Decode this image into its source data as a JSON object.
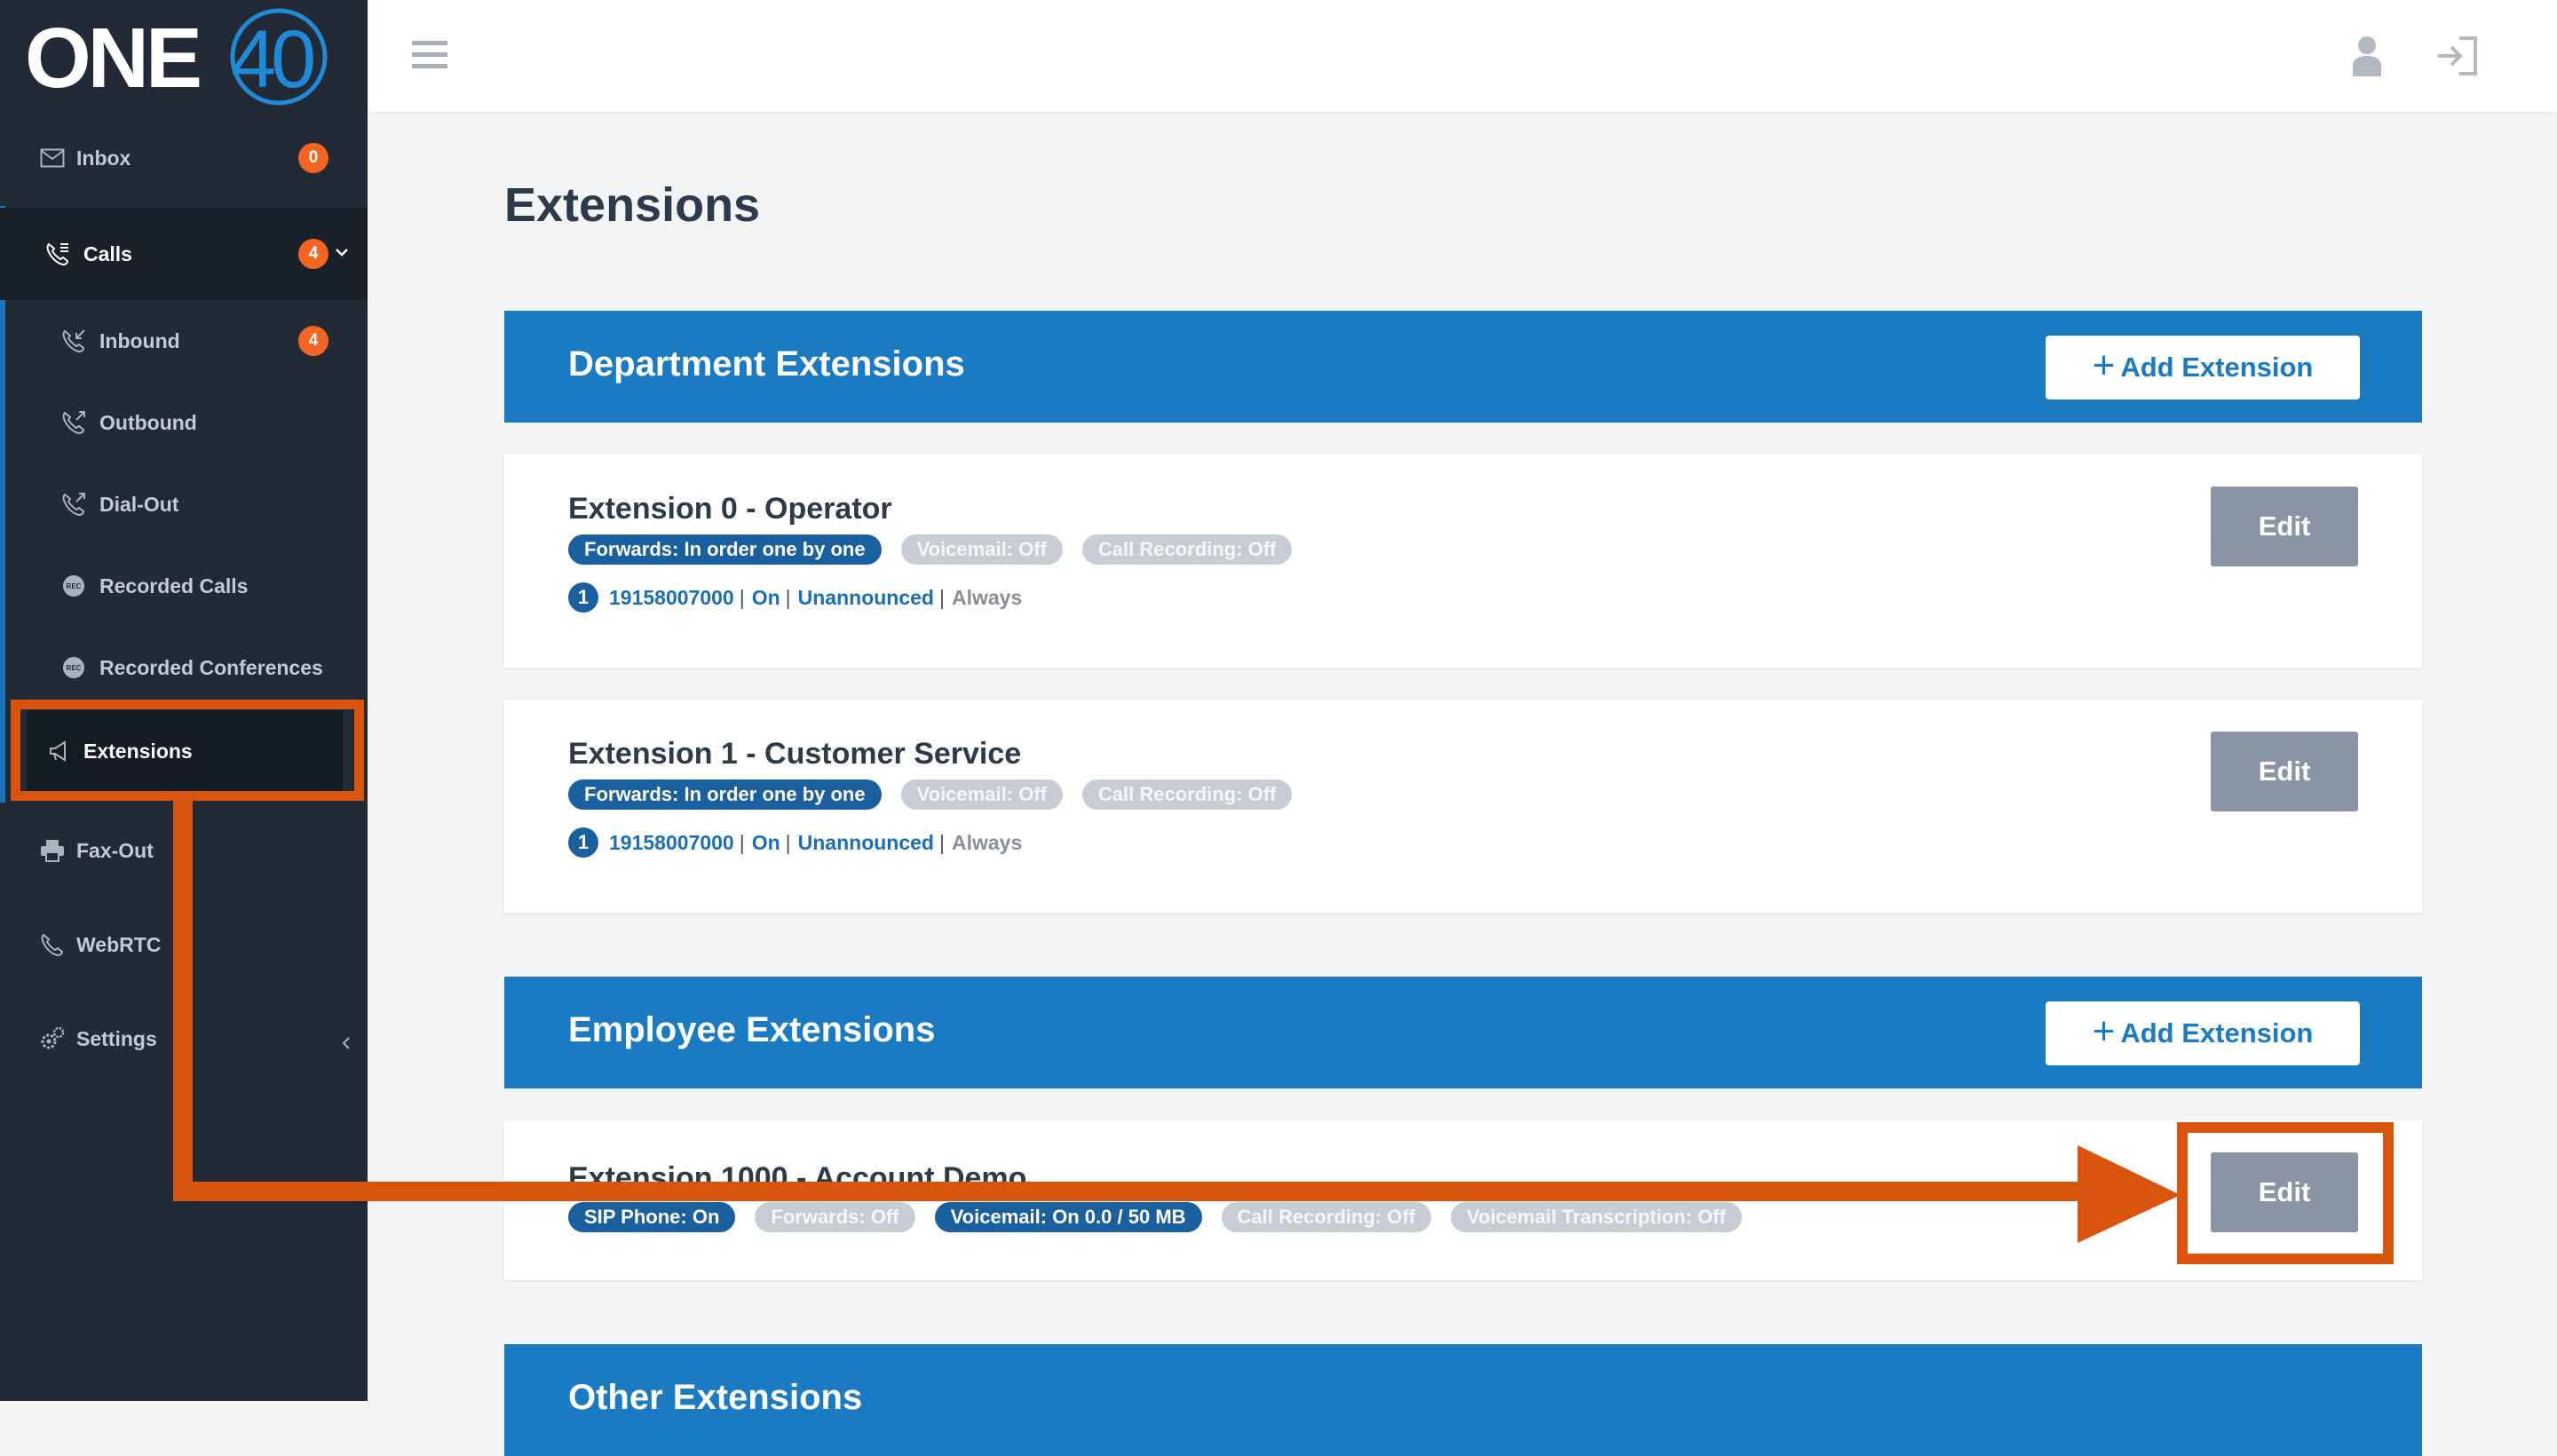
{
  "logo": {
    "text_left": "ONE",
    "text_right": "40"
  },
  "sidebar": {
    "items": [
      {
        "label": "Inbox",
        "badge": "0",
        "icon": "envelope-icon"
      },
      {
        "label": "Calls",
        "badge": "4",
        "icon": "phone-list-icon",
        "expanded": true
      },
      {
        "label": "Inbound",
        "badge": "4",
        "icon": "phone-inbound-icon"
      },
      {
        "label": "Outbound",
        "icon": "phone-outbound-icon"
      },
      {
        "label": "Dial-Out",
        "icon": "phone-dialout-icon"
      },
      {
        "label": "Recorded Calls",
        "icon": "rec-icon"
      },
      {
        "label": "Recorded Conferences",
        "icon": "rec-icon"
      },
      {
        "label": "Extensions",
        "icon": "megaphone-icon",
        "active": true
      },
      {
        "label": "Fax-Out",
        "icon": "printer-icon"
      },
      {
        "label": "WebRTC",
        "icon": "phone-icon"
      },
      {
        "label": "Settings",
        "icon": "gears-icon"
      }
    ]
  },
  "page": {
    "title": "Extensions"
  },
  "sections": {
    "department": {
      "title": "Department Extensions",
      "add_label": "Add Extension"
    },
    "employee": {
      "title": "Employee Extensions",
      "add_label": "Add Extension"
    },
    "other": {
      "title": "Other Extensions"
    }
  },
  "extensions": [
    {
      "title": "Extension 0 - Operator",
      "tags": [
        {
          "text": "Forwards: In order one by one",
          "on": true
        },
        {
          "text": "Voicemail: Off",
          "on": false
        },
        {
          "text": "Call Recording: Off",
          "on": false
        }
      ],
      "forward": {
        "index": "1",
        "number": "19158007000",
        "state": "On",
        "announce": "Unannounced",
        "when": "Always"
      },
      "edit_label": "Edit"
    },
    {
      "title": "Extension 1 - Customer Service",
      "tags": [
        {
          "text": "Forwards: In order one by one",
          "on": true
        },
        {
          "text": "Voicemail: Off",
          "on": false
        },
        {
          "text": "Call Recording: Off",
          "on": false
        }
      ],
      "forward": {
        "index": "1",
        "number": "19158007000",
        "state": "On",
        "announce": "Unannounced",
        "when": "Always"
      },
      "edit_label": "Edit"
    },
    {
      "title": "Extension 1000 - Account Demo",
      "tags": [
        {
          "text": "SIP Phone: On",
          "on": true
        },
        {
          "text": "Forwards: Off",
          "on": false
        },
        {
          "text": "Voicemail: On 0.0 / 50 MB",
          "on": true
        },
        {
          "text": "Call Recording: Off",
          "on": false
        },
        {
          "text": "Voicemail Transcription: Off",
          "on": false
        }
      ],
      "edit_label": "Edit"
    }
  ],
  "colors": {
    "sidebar_bg": "#212a35",
    "accent_blue": "#1a7ac2",
    "badge_orange": "#f26522",
    "annotation_orange": "#d9540c",
    "edit_button": "#8995a4"
  }
}
